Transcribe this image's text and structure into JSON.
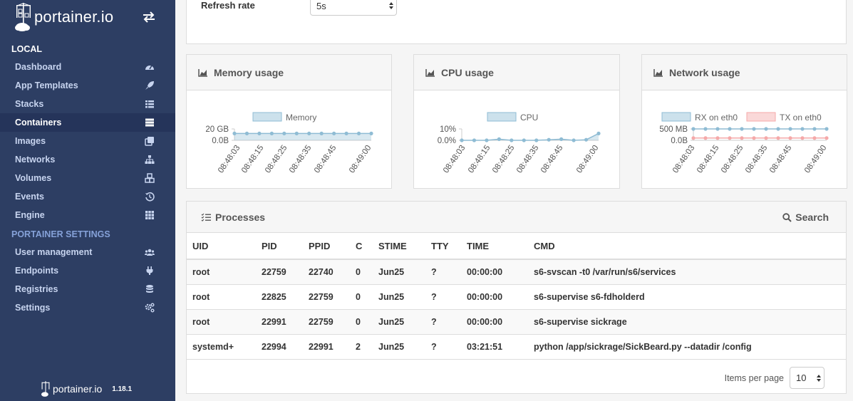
{
  "brand": {
    "name": "portainer.io",
    "version": "1.18.1"
  },
  "sidebar": {
    "section_local": "LOCAL",
    "items_local": [
      {
        "label": "Dashboard",
        "icon": "dashboard-icon"
      },
      {
        "label": "App Templates",
        "icon": "rocket-icon"
      },
      {
        "label": "Stacks",
        "icon": "list-icon"
      },
      {
        "label": "Containers",
        "icon": "server-icon",
        "active": true
      },
      {
        "label": "Images",
        "icon": "clone-icon"
      },
      {
        "label": "Networks",
        "icon": "sitemap-icon"
      },
      {
        "label": "Volumes",
        "icon": "cubes-icon"
      },
      {
        "label": "Events",
        "icon": "history-icon"
      },
      {
        "label": "Engine",
        "icon": "th-icon"
      }
    ],
    "section_settings": "PORTAINER SETTINGS",
    "items_settings": [
      {
        "label": "User management",
        "icon": "users-icon"
      },
      {
        "label": "Endpoints",
        "icon": "plug-icon"
      },
      {
        "label": "Registries",
        "icon": "database-icon"
      },
      {
        "label": "Settings",
        "icon": "cogs-icon"
      }
    ]
  },
  "refresh": {
    "label": "Refresh rate",
    "value": "5s"
  },
  "times": [
    "08:48:03",
    "08:48:15",
    "08:48:25",
    "08:48:35",
    "08:48:45",
    "08:49:00"
  ],
  "memory": {
    "title": "Memory usage",
    "legend": "Memory",
    "y_ticks": [
      "20 GB",
      "0.0B"
    ],
    "values": [
      0.6,
      0.6,
      0.6,
      0.6,
      0.6,
      0.6,
      0.6,
      0.6,
      0.6,
      0.6,
      0.6,
      0.6
    ],
    "color": "#8fbcd4"
  },
  "cpu": {
    "title": "CPU usage",
    "legend": "CPU",
    "y_ticks": [
      "10%",
      "0.0%"
    ],
    "values": [
      0,
      0,
      0,
      0.1,
      0,
      0,
      0,
      0.05,
      0.1,
      0,
      0.05,
      0.6
    ],
    "color": "#8fbcd4"
  },
  "network": {
    "title": "Network usage",
    "legends": [
      "RX on eth0",
      "TX on eth0"
    ],
    "y_ticks": [
      "500 MB",
      "0.0B"
    ],
    "rx": [
      1,
      1,
      1,
      1,
      1,
      1,
      1,
      1,
      1,
      1,
      1,
      1
    ],
    "tx": [
      0.2,
      0.2,
      0.2,
      0.2,
      0.2,
      0.2,
      0.2,
      0.2,
      0.2,
      0.2,
      0.2,
      0.2
    ],
    "rx_color": "#8fbcd4",
    "tx_color": "#f5a9a9"
  },
  "processes": {
    "title": "Processes",
    "search_label": "Search",
    "columns": [
      "UID",
      "PID",
      "PPID",
      "C",
      "STIME",
      "TTY",
      "TIME",
      "CMD"
    ],
    "rows": [
      [
        "root",
        "22759",
        "22740",
        "0",
        "Jun25",
        "?",
        "00:00:00",
        "s6-svscan -t0 /var/run/s6/services"
      ],
      [
        "root",
        "22825",
        "22759",
        "0",
        "Jun25",
        "?",
        "00:00:00",
        "s6-supervise s6-fdholderd"
      ],
      [
        "root",
        "22991",
        "22759",
        "0",
        "Jun25",
        "?",
        "00:00:00",
        "s6-supervise sickrage"
      ],
      [
        "systemd+",
        "22994",
        "22991",
        "2",
        "Jun25",
        "?",
        "03:21:51",
        "python /app/sickrage/SickBeard.py --datadir /config"
      ]
    ],
    "items_per_page_label": "Items per page",
    "items_per_page": "10"
  }
}
